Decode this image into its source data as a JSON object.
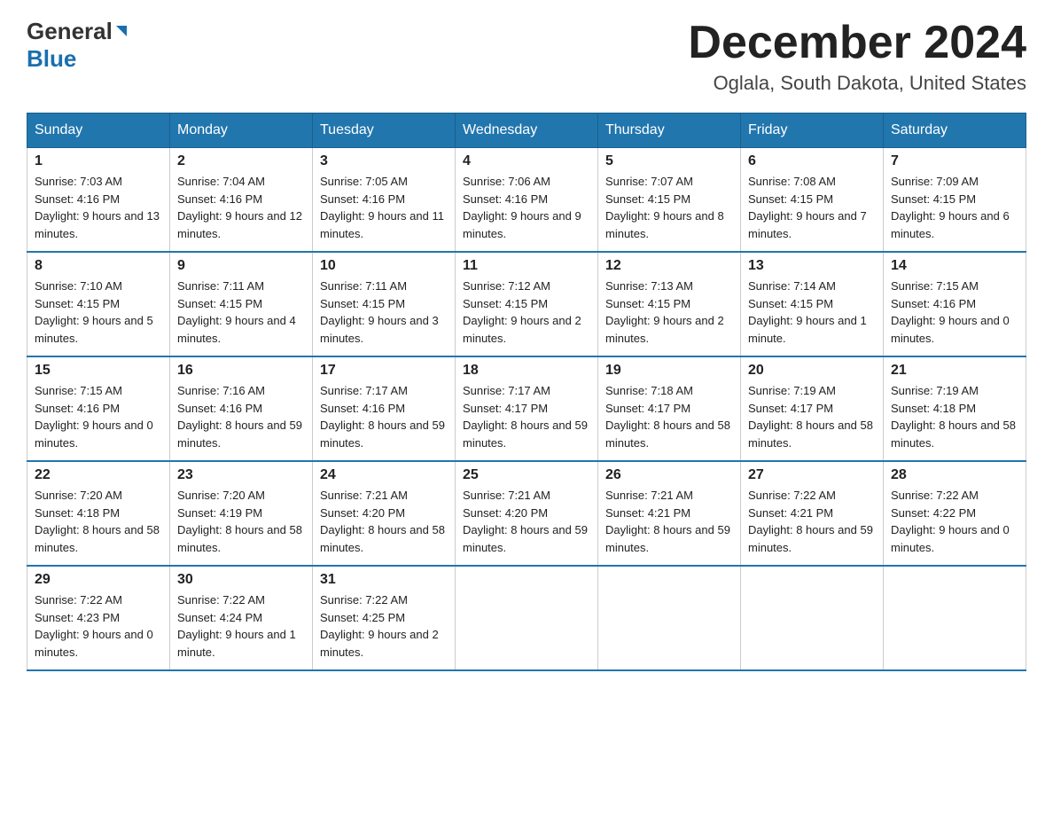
{
  "header": {
    "logo_text1": "General",
    "logo_text2": "Blue",
    "month_title": "December 2024",
    "location": "Oglala, South Dakota, United States"
  },
  "weekdays": [
    "Sunday",
    "Monday",
    "Tuesday",
    "Wednesday",
    "Thursday",
    "Friday",
    "Saturday"
  ],
  "weeks": [
    [
      {
        "day": "1",
        "sunrise": "7:03 AM",
        "sunset": "4:16 PM",
        "daylight": "9 hours and 13 minutes."
      },
      {
        "day": "2",
        "sunrise": "7:04 AM",
        "sunset": "4:16 PM",
        "daylight": "9 hours and 12 minutes."
      },
      {
        "day": "3",
        "sunrise": "7:05 AM",
        "sunset": "4:16 PM",
        "daylight": "9 hours and 11 minutes."
      },
      {
        "day": "4",
        "sunrise": "7:06 AM",
        "sunset": "4:16 PM",
        "daylight": "9 hours and 9 minutes."
      },
      {
        "day": "5",
        "sunrise": "7:07 AM",
        "sunset": "4:15 PM",
        "daylight": "9 hours and 8 minutes."
      },
      {
        "day": "6",
        "sunrise": "7:08 AM",
        "sunset": "4:15 PM",
        "daylight": "9 hours and 7 minutes."
      },
      {
        "day": "7",
        "sunrise": "7:09 AM",
        "sunset": "4:15 PM",
        "daylight": "9 hours and 6 minutes."
      }
    ],
    [
      {
        "day": "8",
        "sunrise": "7:10 AM",
        "sunset": "4:15 PM",
        "daylight": "9 hours and 5 minutes."
      },
      {
        "day": "9",
        "sunrise": "7:11 AM",
        "sunset": "4:15 PM",
        "daylight": "9 hours and 4 minutes."
      },
      {
        "day": "10",
        "sunrise": "7:11 AM",
        "sunset": "4:15 PM",
        "daylight": "9 hours and 3 minutes."
      },
      {
        "day": "11",
        "sunrise": "7:12 AM",
        "sunset": "4:15 PM",
        "daylight": "9 hours and 2 minutes."
      },
      {
        "day": "12",
        "sunrise": "7:13 AM",
        "sunset": "4:15 PM",
        "daylight": "9 hours and 2 minutes."
      },
      {
        "day": "13",
        "sunrise": "7:14 AM",
        "sunset": "4:15 PM",
        "daylight": "9 hours and 1 minute."
      },
      {
        "day": "14",
        "sunrise": "7:15 AM",
        "sunset": "4:16 PM",
        "daylight": "9 hours and 0 minutes."
      }
    ],
    [
      {
        "day": "15",
        "sunrise": "7:15 AM",
        "sunset": "4:16 PM",
        "daylight": "9 hours and 0 minutes."
      },
      {
        "day": "16",
        "sunrise": "7:16 AM",
        "sunset": "4:16 PM",
        "daylight": "8 hours and 59 minutes."
      },
      {
        "day": "17",
        "sunrise": "7:17 AM",
        "sunset": "4:16 PM",
        "daylight": "8 hours and 59 minutes."
      },
      {
        "day": "18",
        "sunrise": "7:17 AM",
        "sunset": "4:17 PM",
        "daylight": "8 hours and 59 minutes."
      },
      {
        "day": "19",
        "sunrise": "7:18 AM",
        "sunset": "4:17 PM",
        "daylight": "8 hours and 58 minutes."
      },
      {
        "day": "20",
        "sunrise": "7:19 AM",
        "sunset": "4:17 PM",
        "daylight": "8 hours and 58 minutes."
      },
      {
        "day": "21",
        "sunrise": "7:19 AM",
        "sunset": "4:18 PM",
        "daylight": "8 hours and 58 minutes."
      }
    ],
    [
      {
        "day": "22",
        "sunrise": "7:20 AM",
        "sunset": "4:18 PM",
        "daylight": "8 hours and 58 minutes."
      },
      {
        "day": "23",
        "sunrise": "7:20 AM",
        "sunset": "4:19 PM",
        "daylight": "8 hours and 58 minutes."
      },
      {
        "day": "24",
        "sunrise": "7:21 AM",
        "sunset": "4:20 PM",
        "daylight": "8 hours and 58 minutes."
      },
      {
        "day": "25",
        "sunrise": "7:21 AM",
        "sunset": "4:20 PM",
        "daylight": "8 hours and 59 minutes."
      },
      {
        "day": "26",
        "sunrise": "7:21 AM",
        "sunset": "4:21 PM",
        "daylight": "8 hours and 59 minutes."
      },
      {
        "day": "27",
        "sunrise": "7:22 AM",
        "sunset": "4:21 PM",
        "daylight": "8 hours and 59 minutes."
      },
      {
        "day": "28",
        "sunrise": "7:22 AM",
        "sunset": "4:22 PM",
        "daylight": "9 hours and 0 minutes."
      }
    ],
    [
      {
        "day": "29",
        "sunrise": "7:22 AM",
        "sunset": "4:23 PM",
        "daylight": "9 hours and 0 minutes."
      },
      {
        "day": "30",
        "sunrise": "7:22 AM",
        "sunset": "4:24 PM",
        "daylight": "9 hours and 1 minute."
      },
      {
        "day": "31",
        "sunrise": "7:22 AM",
        "sunset": "4:25 PM",
        "daylight": "9 hours and 2 minutes."
      },
      null,
      null,
      null,
      null
    ]
  ],
  "labels": {
    "sunrise": "Sunrise:",
    "sunset": "Sunset:",
    "daylight": "Daylight:"
  }
}
